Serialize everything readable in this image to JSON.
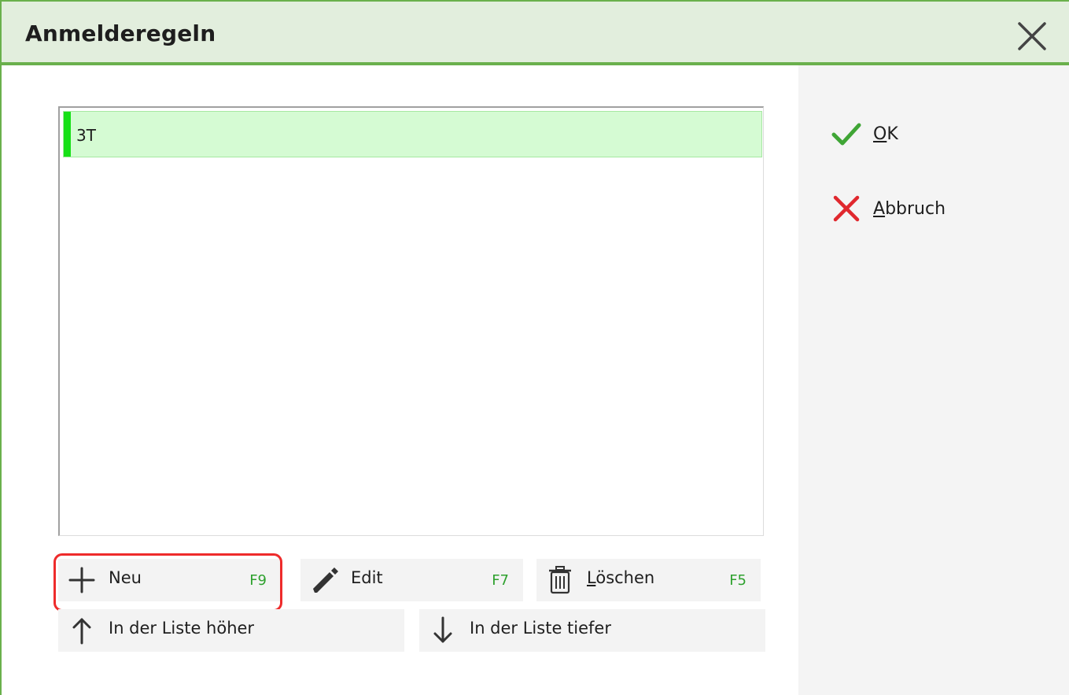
{
  "window": {
    "title": "Anmelderegeln"
  },
  "side_buttons": {
    "ok_label_first": "O",
    "ok_label_rest": "K",
    "cancel_label_first": "A",
    "cancel_label_rest": "bbruch"
  },
  "list": {
    "items": [
      {
        "label": "3T",
        "selected": true
      }
    ]
  },
  "buttons": {
    "new": {
      "label": "Neu",
      "key": "F9"
    },
    "edit": {
      "label": "Edit",
      "key": "F7"
    },
    "delete": {
      "label_first": "L",
      "label_rest": "öschen",
      "key": "F5"
    },
    "up": {
      "label": "In der Liste höher"
    },
    "down": {
      "label": "In der Liste tiefer"
    }
  },
  "colors": {
    "accent_green": "#6ab04c",
    "titlebar_bg": "#e2eedd",
    "selected_row_bg": "#d5fbd3",
    "selected_marker": "#17e017",
    "shortcut_green": "#2ea12e",
    "highlight_red": "#ee2b2b"
  },
  "icons": {
    "close": "close-icon",
    "ok": "checkmark-icon",
    "cancel": "x-icon",
    "new": "plus-icon",
    "edit": "pencil-icon",
    "delete": "trash-icon",
    "up": "arrow-up-icon",
    "down": "arrow-down-icon"
  }
}
